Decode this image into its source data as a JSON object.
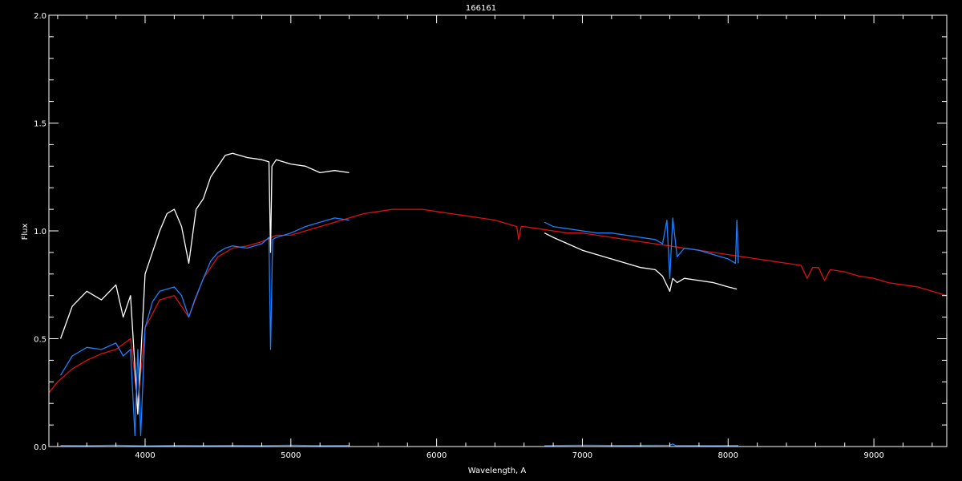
{
  "chart_data": {
    "type": "line",
    "title": "166161",
    "xlabel": "Wavelength, A",
    "ylabel": "Flux",
    "xlim": [
      3340,
      9500
    ],
    "ylim": [
      0,
      2.0
    ],
    "x_ticks": [
      4000,
      5000,
      6000,
      7000,
      8000,
      9000
    ],
    "x_tick_labels": [
      "4000",
      "5000",
      "6000",
      "7000",
      "8000",
      "9000"
    ],
    "y_ticks": [
      0,
      0.5,
      1.0,
      1.5,
      2.0
    ],
    "y_tick_labels": [
      "0.0",
      "0.5",
      "1.0",
      "1.5",
      "2.0"
    ],
    "grid": false,
    "background": "#000000",
    "axis_color": "#ffffff",
    "series": [
      {
        "color": "#dd1111",
        "x": [
          3340,
          3400,
          3500,
          3600,
          3700,
          3800,
          3900,
          3950,
          4000,
          4100,
          4200,
          4300,
          4400,
          4500,
          4600,
          4700,
          4800,
          4900,
          5000,
          5100,
          5200,
          5300,
          5400,
          5500,
          5600,
          5700,
          5800,
          5900,
          6000,
          6100,
          6200,
          6300,
          6400,
          6500,
          6550,
          6563,
          6580,
          6600,
          6700,
          6800,
          6900,
          7000,
          7100,
          7200,
          7300,
          7400,
          7500,
          7600,
          7700,
          7800,
          7900,
          8000,
          8100,
          8200,
          8300,
          8400,
          8500,
          8542,
          8580,
          8620,
          8662,
          8700,
          8800,
          8900,
          9000,
          9100,
          9200,
          9300,
          9400,
          9500
        ],
        "y": [
          0.25,
          0.3,
          0.36,
          0.4,
          0.43,
          0.45,
          0.5,
          0.2,
          0.55,
          0.68,
          0.7,
          0.6,
          0.78,
          0.88,
          0.92,
          0.93,
          0.95,
          0.98,
          0.98,
          1.0,
          1.02,
          1.04,
          1.06,
          1.08,
          1.09,
          1.1,
          1.1,
          1.1,
          1.09,
          1.08,
          1.07,
          1.06,
          1.05,
          1.03,
          1.02,
          0.96,
          1.02,
          1.02,
          1.01,
          1.0,
          0.99,
          0.99,
          0.98,
          0.97,
          0.96,
          0.95,
          0.94,
          0.93,
          0.92,
          0.91,
          0.9,
          0.89,
          0.88,
          0.87,
          0.86,
          0.85,
          0.84,
          0.78,
          0.83,
          0.83,
          0.77,
          0.82,
          0.81,
          0.79,
          0.78,
          0.76,
          0.75,
          0.74,
          0.72,
          0.7
        ]
      },
      {
        "color": "#ffffff",
        "x": [
          3420,
          3500,
          3600,
          3700,
          3800,
          3850,
          3900,
          3950,
          4000,
          4050,
          4100,
          4150,
          4200,
          4250,
          4300,
          4350,
          4400,
          4450,
          4500,
          4550,
          4600,
          4700,
          4800,
          4850,
          4861,
          4870,
          4900,
          5000,
          5100,
          5200,
          5300,
          5400
        ],
        "y": [
          0.5,
          0.65,
          0.72,
          0.68,
          0.75,
          0.6,
          0.7,
          0.15,
          0.8,
          0.9,
          1.0,
          1.08,
          1.1,
          1.02,
          0.85,
          1.1,
          1.15,
          1.25,
          1.3,
          1.35,
          1.36,
          1.34,
          1.33,
          1.32,
          0.9,
          1.3,
          1.33,
          1.31,
          1.3,
          1.27,
          1.28,
          1.27
        ]
      },
      {
        "color": "#ffffff",
        "x": [
          6740,
          6800,
          6900,
          7000,
          7100,
          7200,
          7300,
          7400,
          7500,
          7550,
          7600,
          7620,
          7650,
          7700,
          7800,
          7900,
          8000,
          8060
        ],
        "y": [
          0.99,
          0.97,
          0.94,
          0.91,
          0.89,
          0.87,
          0.85,
          0.83,
          0.82,
          0.79,
          0.72,
          0.78,
          0.76,
          0.78,
          0.77,
          0.76,
          0.74,
          0.73
        ]
      },
      {
        "color": "#1e7fff",
        "x": [
          3420,
          3500,
          3600,
          3700,
          3800,
          3850,
          3900,
          3930,
          3950,
          3970,
          4000,
          4050,
          4100,
          4150,
          4200,
          4250,
          4300,
          4340,
          4400,
          4450,
          4500,
          4550,
          4600,
          4700,
          4800,
          4850,
          4861,
          4875,
          4900,
          5000,
          5100,
          5200,
          5300,
          5400
        ],
        "y": [
          0.33,
          0.42,
          0.46,
          0.45,
          0.48,
          0.42,
          0.45,
          0.05,
          0.45,
          0.05,
          0.55,
          0.67,
          0.72,
          0.73,
          0.74,
          0.7,
          0.6,
          0.68,
          0.78,
          0.86,
          0.9,
          0.92,
          0.93,
          0.92,
          0.94,
          0.97,
          0.45,
          0.96,
          0.97,
          0.99,
          1.02,
          1.04,
          1.06,
          1.05
        ]
      },
      {
        "color": "#1e7fff",
        "x": [
          6740,
          6800,
          6900,
          7000,
          7100,
          7200,
          7300,
          7400,
          7500,
          7550,
          7580,
          7600,
          7620,
          7650,
          7700,
          7800,
          7900,
          8000,
          8050,
          8060,
          8070
        ],
        "y": [
          1.04,
          1.02,
          1.01,
          1.0,
          0.99,
          0.99,
          0.98,
          0.97,
          0.96,
          0.94,
          1.05,
          0.78,
          1.06,
          0.88,
          0.92,
          0.91,
          0.89,
          0.87,
          0.85,
          1.05,
          0.85
        ]
      },
      {
        "color": "#1e7fff",
        "x": [
          3420,
          3600,
          3800,
          4000,
          4200,
          4400,
          4600,
          4800,
          5000,
          5200,
          5400
        ],
        "y": [
          0.005,
          0.004,
          0.006,
          0.003,
          0.005,
          0.004,
          0.005,
          0.004,
          0.006,
          0.004,
          0.005
        ]
      },
      {
        "color": "#1e7fff",
        "x": [
          6740,
          7000,
          7300,
          7600,
          7620,
          7640,
          7900,
          8070
        ],
        "y": [
          0.004,
          0.006,
          0.005,
          0.006,
          0.012,
          0.005,
          0.004,
          0.005
        ]
      }
    ]
  }
}
